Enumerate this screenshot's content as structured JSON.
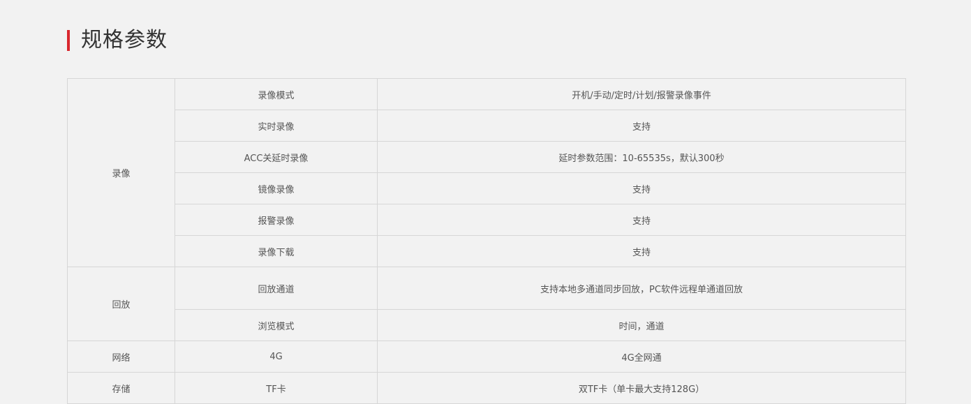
{
  "section": {
    "title": "规格参数",
    "accent_color": "#d9272e"
  },
  "spec_table": {
    "groups": [
      {
        "category": "录像",
        "rows": [
          {
            "param": "录像模式",
            "value": "开机/手动/定时/计划/报警录像事件"
          },
          {
            "param": "实时录像",
            "value": "支持"
          },
          {
            "param": "ACC关延时录像",
            "value": "延时参数范围：10-65535s，默认300秒"
          },
          {
            "param": "镜像录像",
            "value": "支持"
          },
          {
            "param": "报警录像",
            "value": "支持"
          },
          {
            "param": "录像下载",
            "value": "支持"
          }
        ]
      },
      {
        "category": "回放",
        "rows": [
          {
            "param": "回放通道",
            "value": "支持本地多通道同步回放，PC软件远程单通道回放"
          },
          {
            "param": "浏览模式",
            "value": "时间，通道"
          }
        ]
      },
      {
        "category": "网络",
        "rows": [
          {
            "param": "4G",
            "value": "4G全网通"
          }
        ]
      },
      {
        "category": "存储",
        "rows": [
          {
            "param": "TF卡",
            "value": "双TF卡（单卡最大支持128G）"
          }
        ]
      }
    ]
  }
}
